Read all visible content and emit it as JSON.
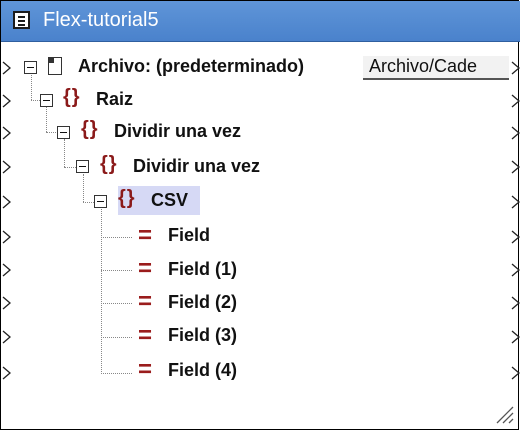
{
  "window": {
    "title": "Flex-tutorial5"
  },
  "root": {
    "label": "Archivo: (predeterminado)",
    "tab_label": "Archivo/Cade"
  },
  "tree": [
    {
      "label": "Raiz",
      "kind": "group"
    },
    {
      "label": "Dividir una vez",
      "kind": "group"
    },
    {
      "label": "Dividir una vez",
      "kind": "group"
    },
    {
      "label": "CSV",
      "kind": "group",
      "selected": true
    },
    {
      "label": "Field",
      "kind": "field"
    },
    {
      "label": "Field (1)",
      "kind": "field"
    },
    {
      "label": "Field (2)",
      "kind": "field"
    },
    {
      "label": "Field (3)",
      "kind": "field"
    },
    {
      "label": "Field (4)",
      "kind": "field"
    }
  ],
  "icons": {
    "title": "document-icon",
    "root": "file-icon",
    "group": "braces-icon",
    "field": "field-icon",
    "connector": "connector-triangle-icon",
    "expander": "collapse-icon",
    "resize": "resize-grip-icon"
  },
  "colors": {
    "titlebar": "#4a82cc",
    "braces": "#8b1a1a",
    "selection": "#d6d9f5"
  }
}
